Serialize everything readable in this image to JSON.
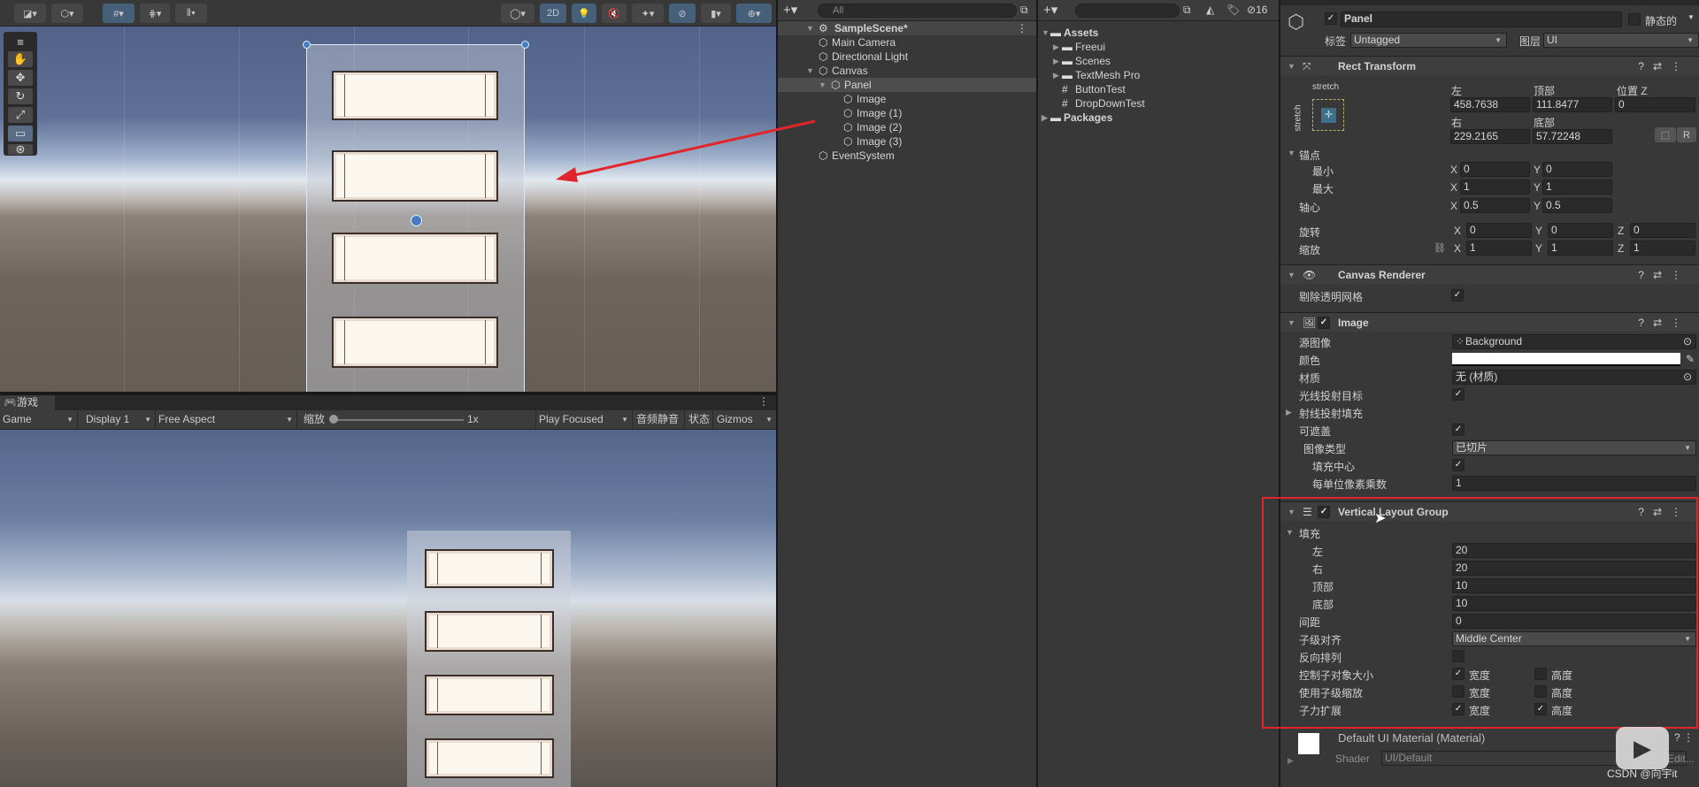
{
  "scene": {
    "toolbar": {
      "mode_2d": "2D"
    },
    "tools": [
      "hand-tool",
      "move-tool",
      "rotate-tool",
      "scale-tool",
      "rect-tool",
      "transform-tool"
    ]
  },
  "game": {
    "tab_label": "游戏",
    "display_mode": "Game",
    "display": "Display 1",
    "aspect": "Free Aspect",
    "scale_label": "缩放",
    "scale_value": "1x",
    "scale_fraction": 0,
    "play_mode": "Play Focused",
    "mute": "音频静音",
    "stats": "状态",
    "gizmos": "Gizmos"
  },
  "hierarchy": {
    "search_placeholder": "All",
    "scene": "SampleScene*",
    "items": [
      {
        "label": "Main Camera",
        "depth": 1
      },
      {
        "label": "Directional Light",
        "depth": 1
      },
      {
        "label": "Canvas",
        "depth": 1,
        "expanded": true
      },
      {
        "label": "Panel",
        "depth": 2,
        "expanded": true,
        "selected": true
      },
      {
        "label": "Image",
        "depth": 3
      },
      {
        "label": "Image (1)",
        "depth": 3
      },
      {
        "label": "Image (2)",
        "depth": 3
      },
      {
        "label": "Image (3)",
        "depth": 3
      },
      {
        "label": "EventSystem",
        "depth": 1
      }
    ]
  },
  "project": {
    "hidden_count": "16",
    "items": [
      {
        "label": "Assets",
        "type": "folder-open",
        "depth": 0,
        "bold": true
      },
      {
        "label": "Freeui",
        "type": "folder",
        "depth": 1
      },
      {
        "label": "Scenes",
        "type": "folder",
        "depth": 1
      },
      {
        "label": "TextMesh Pro",
        "type": "folder",
        "depth": 1
      },
      {
        "label": "ButtonTest",
        "type": "script",
        "depth": 1
      },
      {
        "label": "DropDownTest",
        "type": "script",
        "depth": 1
      },
      {
        "label": "Packages",
        "type": "folder",
        "depth": 0,
        "bold": true
      }
    ]
  },
  "inspector": {
    "object_name": "Panel",
    "static_label": "静态的",
    "tag_label": "标签",
    "tag": "Untagged",
    "layer_label": "图层",
    "layer": "UI",
    "rect_transform": {
      "title": "Rect Transform",
      "preset": "stretch",
      "left_label": "左",
      "left": "458.7638",
      "top_label": "顶部",
      "top": "111.8477",
      "posz_label": "位置 Z",
      "posz": "0",
      "right_label": "右",
      "right": "229.2165",
      "bottom_label": "底部",
      "bottom": "57.72248",
      "r_button": "R",
      "anchors_label": "锚点",
      "min_label": "最小",
      "min_x": "0",
      "min_y": "0",
      "max_label": "最大",
      "max_x": "1",
      "max_y": "1",
      "pivot_label": "轴心",
      "pivot_x": "0.5",
      "pivot_y": "0.5",
      "rotation_label": "旋转",
      "rot_x": "0",
      "rot_y": "0",
      "rot_z": "0",
      "scale_label": "缩放",
      "scale_x": "1",
      "scale_y": "1",
      "scale_z": "1"
    },
    "canvas_renderer": {
      "title": "Canvas Renderer",
      "cull_label": "剔除透明网格",
      "cull": true
    },
    "image": {
      "title": "Image",
      "rows": [
        {
          "label": "源图像",
          "type": "object",
          "value": "Background"
        },
        {
          "label": "颜色",
          "type": "color",
          "value": "#ffffff"
        },
        {
          "label": "材质",
          "type": "object",
          "value": "无 (材质)"
        },
        {
          "label": "光线投射目标",
          "type": "check",
          "value": true
        },
        {
          "label": "射线投射填充",
          "type": "foldout"
        },
        {
          "label": "可遮盖",
          "type": "check",
          "value": true
        },
        {
          "label": "图像类型",
          "type": "dropdown",
          "value": "已切片",
          "indent": 1
        },
        {
          "label": "填充中心",
          "type": "check",
          "value": true,
          "indent": 2
        },
        {
          "label": "每单位像素乘数",
          "type": "field",
          "value": "1",
          "indent": 2
        }
      ]
    },
    "vlg": {
      "title": "Vertical Layout Group",
      "rows": [
        {
          "label": "填充",
          "type": "foldout-open"
        },
        {
          "label": "左",
          "type": "field",
          "value": "20",
          "indent": 2
        },
        {
          "label": "右",
          "type": "field",
          "value": "20",
          "indent": 2
        },
        {
          "label": "顶部",
          "type": "field",
          "value": "10",
          "indent": 2
        },
        {
          "label": "底部",
          "type": "field",
          "value": "10",
          "indent": 2
        },
        {
          "label": "间距",
          "type": "field",
          "value": "0"
        },
        {
          "label": "子级对齐",
          "type": "dropdown",
          "value": "Middle Center"
        },
        {
          "label": "反向排列",
          "type": "check",
          "value": false
        },
        {
          "label": "控制子对象大小",
          "type": "pair",
          "w_label": "宽度",
          "w": true,
          "h_label": "高度",
          "h": false
        },
        {
          "label": "使用子级缩放",
          "type": "pair",
          "w_label": "宽度",
          "w": false,
          "h_label": "高度",
          "h": false
        },
        {
          "label": "子力扩展",
          "type": "pair",
          "w_label": "宽度",
          "w": true,
          "h_label": "高度",
          "h": true
        }
      ]
    },
    "material": {
      "name": "Default UI Material (Material)",
      "shader_label": "Shader",
      "shader": "UI/Default",
      "edit": "Edit..."
    }
  },
  "watermark": "CSDN @向宇it",
  "colors": {
    "annotation": "#e0262b",
    "selection": "#46607c"
  }
}
